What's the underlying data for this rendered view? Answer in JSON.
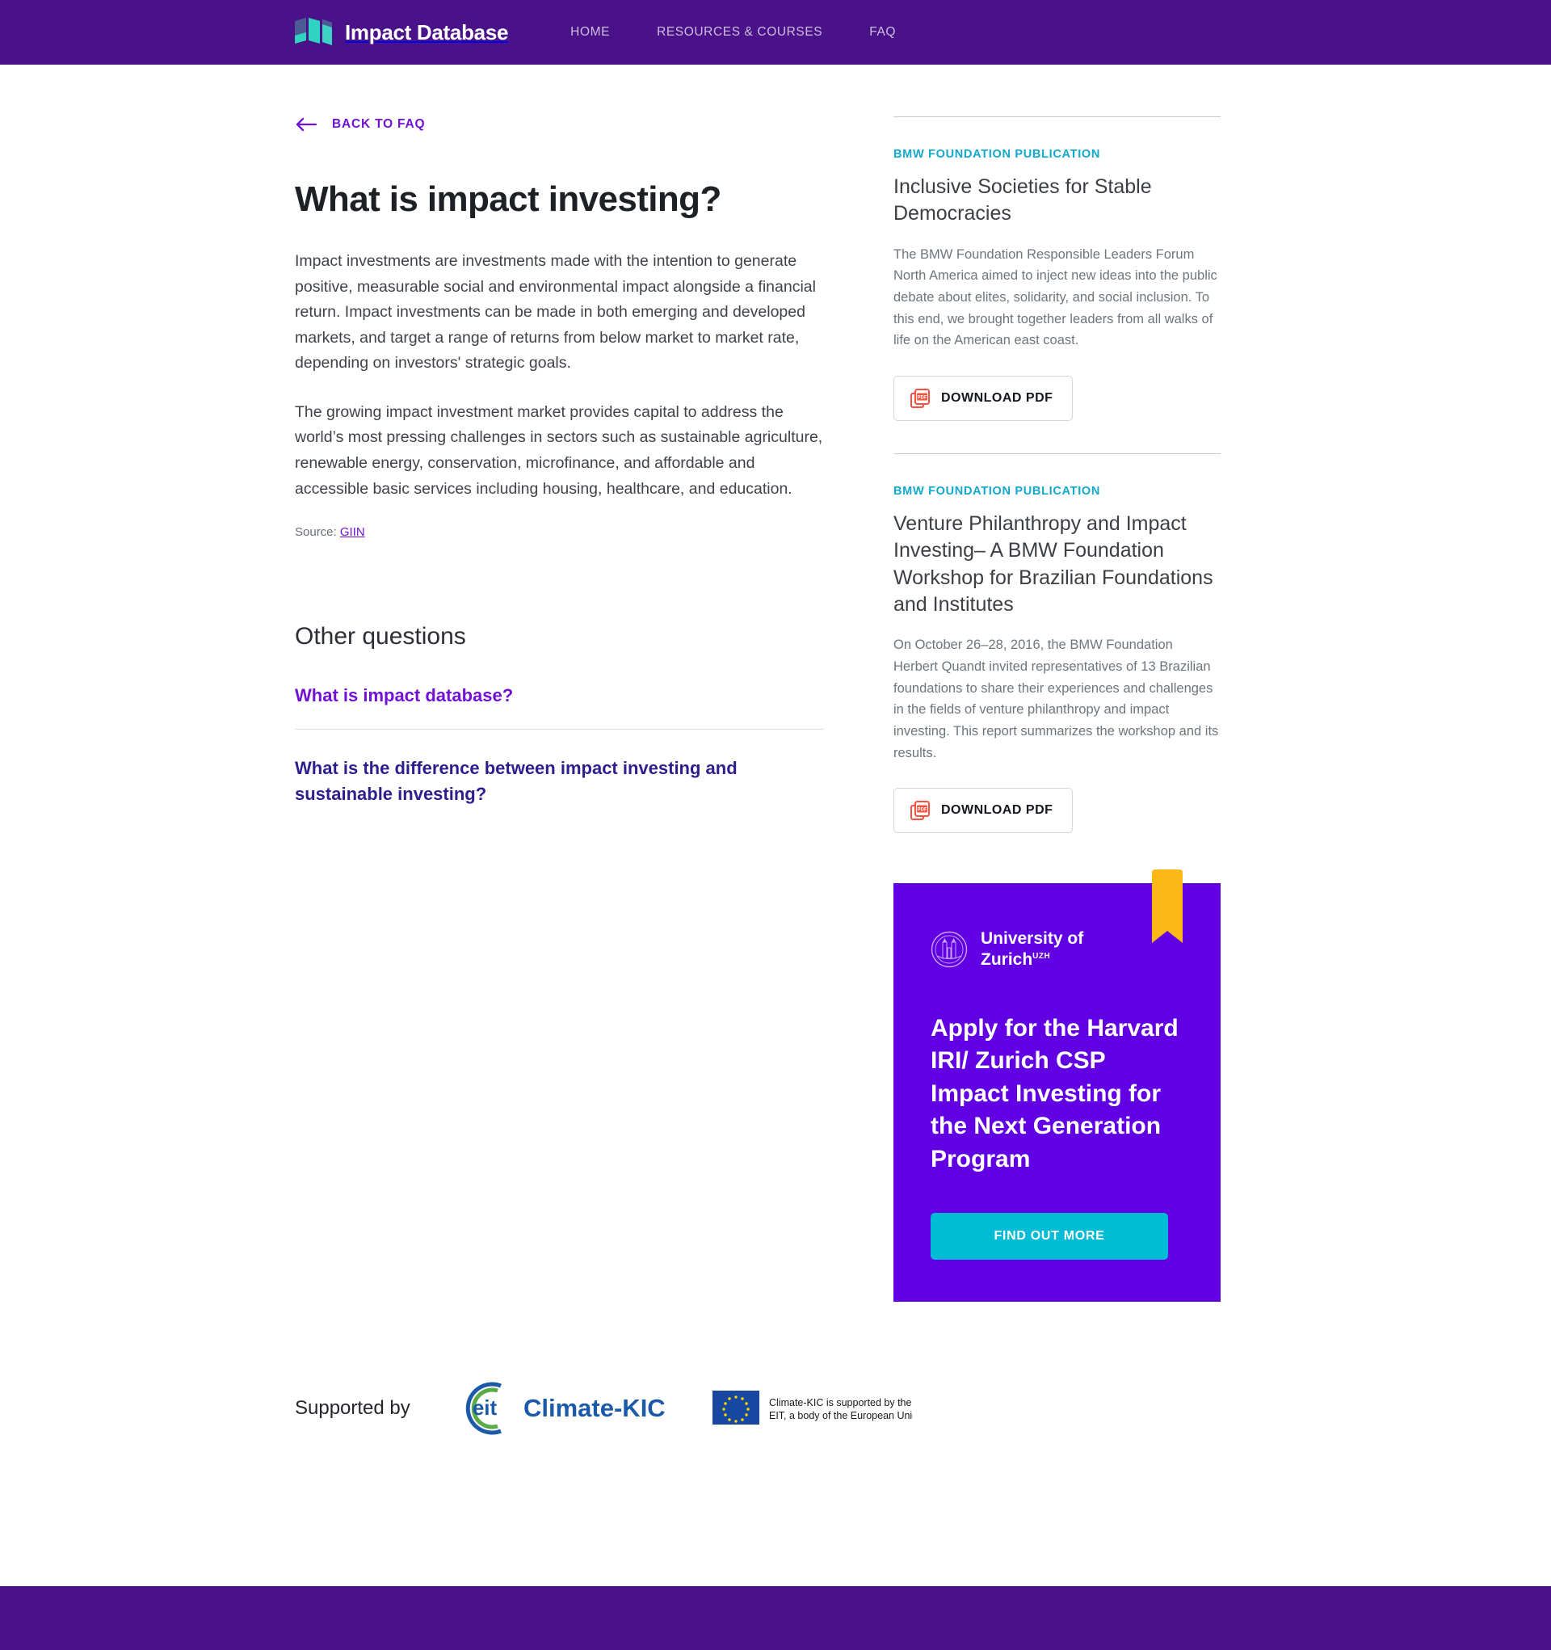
{
  "header": {
    "brand_name": "Impact Database",
    "logo_icon": "map-book-icon",
    "nav": [
      {
        "label": "HOME",
        "name": "home"
      },
      {
        "label": "RESOURCES & COURSES",
        "name": "resources-courses"
      },
      {
        "label": "FAQ",
        "name": "faq"
      }
    ]
  },
  "back": {
    "label": "BACK TO FAQ",
    "icon": "arrow-left-icon"
  },
  "article": {
    "title": "What is impact investing?",
    "paragraphs": [
      "Impact investments are investments made with the intention to generate positive, measurable social and environmental impact alongside a financial return. Impact investments can be made in both emerging and developed markets, and target a range of returns from below market to market rate, depending on investors' strategic goals.",
      "The growing impact investment market provides capital to address the world’s most pressing challenges in sectors such as sustainable agriculture, renewable energy, conservation, microfinance, and affordable and accessible basic services including housing, healthcare, and education."
    ],
    "source_prefix": "Source: ",
    "source_link": "GIIN"
  },
  "other_questions": {
    "heading": "Other questions",
    "items": [
      {
        "label": "What is impact database?",
        "style": "violet"
      },
      {
        "label": "What is the difference between impact investing and sustainable investing?",
        "style": "indigo"
      }
    ]
  },
  "sidebar": {
    "publications": [
      {
        "kicker": "BMW FOUNDATION PUBLICATION",
        "title": "Inclusive Societies for Stable Democracies",
        "description": "The BMW Foundation Responsible Leaders Forum North America aimed to inject new ideas into the public debate about elites, solidarity, and social inclusion. To this end, we brought together leaders from all walks of life on the American east coast.",
        "download_label": "DOWNLOAD PDF",
        "download_icon": "pdf-icon"
      },
      {
        "kicker": "BMW FOUNDATION PUBLICATION",
        "title": "Venture Philanthropy and Impact Investing– A BMW Foundation Workshop for Brazilian Foundations and Institutes",
        "description": "On October 26–28, 2016, the BMW Foundation Herbert Quandt invited representatives of 13 Brazilian foundations to share their experiences and challenges in the fields of venture philanthropy and impact investing. This report summarizes the workshop and its results.",
        "download_label": "DOWNLOAD PDF",
        "download_icon": "pdf-icon"
      }
    ],
    "promo": {
      "ribbon_icon": "bookmark-ribbon-icon",
      "org_seal_icon": "uzh-seal-icon",
      "org_line1": "University of",
      "org_line2": "Zurich",
      "org_superscript": "UZH",
      "headline": "Apply for the Harvard IRI/ Zurich CSP Impact Investing for the Next Generation Program",
      "cta_label": "FIND OUT MORE"
    }
  },
  "supported": {
    "label": "Supported by",
    "kic_logo_icon": "eit-climate-kic-logo",
    "kic_wordmark": "Climate-KIC",
    "kic_mark": "eit",
    "eu_logo_icon": "eu-flag-icon",
    "eu_text_line1": "Climate-KIC is supported by the",
    "eu_text_line2": "EIT, a body of the European Union"
  },
  "colors": {
    "brand_purple": "#4a1289",
    "accent_violet": "#7011d4",
    "promo_purple": "#6100e2",
    "cyan": "#00bcd4",
    "kicker_teal": "#11a8cd",
    "ribbon_yellow": "#fcb817",
    "indigo": "#2c1e8c"
  }
}
